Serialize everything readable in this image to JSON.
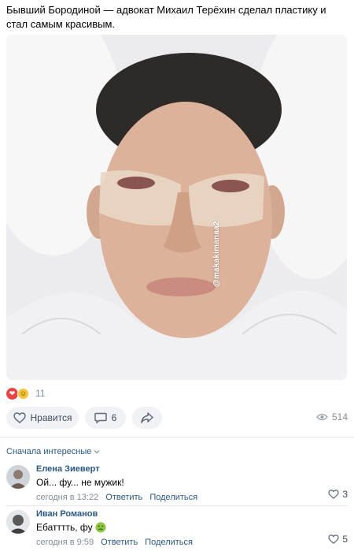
{
  "post": {
    "text": "Бывший Бородиной — адвокат Михаил Терёхин сделал пластику и стал самым красивым.",
    "watermark": "@makakimanaa2"
  },
  "reactions": {
    "icons": [
      "heart-icon",
      "laugh-icon"
    ],
    "count": "11"
  },
  "actions": {
    "like_label": "Нравится",
    "comment_count": "6",
    "views": "514"
  },
  "comments_header": {
    "sort_label": "Сначала интересные"
  },
  "comments": [
    {
      "author": "Елена Зиеверт",
      "text": "Ой... фу... не мужик!",
      "time": "сегодня в 13:22",
      "reply_label": "Ответить",
      "share_label": "Поделиться",
      "likes": "3"
    },
    {
      "author": "Иван Романов",
      "text": "Ебатттть, фу",
      "emoji": "nauseated-face-icon",
      "time": "сегодня в 9:59",
      "reply_label": "Ответить",
      "share_label": "Поделиться",
      "likes": "5"
    }
  ],
  "colors": {
    "link": "#2a5885",
    "secondary": "#818c99",
    "pill_bg": "#f0f2f5",
    "heart": "#e64646"
  }
}
